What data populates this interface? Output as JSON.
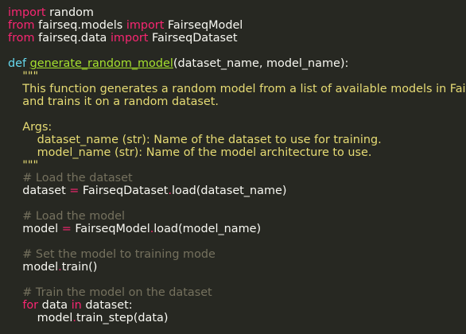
{
  "lines": [
    {
      "segs": [
        {
          "t": "import",
          "c": "kw"
        },
        {
          "t": " random",
          "c": ""
        }
      ]
    },
    {
      "segs": [
        {
          "t": "from",
          "c": "kw"
        },
        {
          "t": " fairseq.models ",
          "c": ""
        },
        {
          "t": "import",
          "c": "kw"
        },
        {
          "t": " FairseqModel",
          "c": ""
        }
      ]
    },
    {
      "segs": [
        {
          "t": "from",
          "c": "kw"
        },
        {
          "t": " fairseq.data ",
          "c": ""
        },
        {
          "t": "import",
          "c": "kw"
        },
        {
          "t": " FairseqDataset",
          "c": ""
        }
      ]
    },
    {
      "segs": []
    },
    {
      "segs": [
        {
          "t": "def",
          "c": "def"
        },
        {
          "t": " ",
          "c": ""
        },
        {
          "t": "generate_random_model",
          "c": "fn"
        },
        {
          "t": "(dataset_name, model_name):",
          "c": ""
        }
      ]
    },
    {
      "segs": [
        {
          "t": "    \"\"\"",
          "c": "str"
        }
      ]
    },
    {
      "segs": [
        {
          "t": "    This function generates a random model from a list of available models in Fairseq",
          "c": "str"
        }
      ]
    },
    {
      "segs": [
        {
          "t": "    and trains it on a random dataset.",
          "c": "str"
        }
      ]
    },
    {
      "segs": []
    },
    {
      "segs": [
        {
          "t": "    Args:",
          "c": "str"
        }
      ]
    },
    {
      "segs": [
        {
          "t": "        dataset_name (str): Name of the dataset to use for training.",
          "c": "str"
        }
      ]
    },
    {
      "segs": [
        {
          "t": "        model_name (str): Name of the model architecture to use.",
          "c": "str"
        }
      ]
    },
    {
      "segs": [
        {
          "t": "    \"\"\"",
          "c": "str"
        }
      ]
    },
    {
      "segs": [
        {
          "t": "    # Load the dataset",
          "c": "cm"
        }
      ]
    },
    {
      "segs": [
        {
          "t": "    dataset ",
          "c": ""
        },
        {
          "t": "=",
          "c": "op"
        },
        {
          "t": " FairseqDataset",
          "c": ""
        },
        {
          "t": ".",
          "c": "op"
        },
        {
          "t": "load(dataset_name)",
          "c": ""
        }
      ]
    },
    {
      "segs": []
    },
    {
      "segs": [
        {
          "t": "    # Load the model",
          "c": "cm"
        }
      ]
    },
    {
      "segs": [
        {
          "t": "    model ",
          "c": ""
        },
        {
          "t": "=",
          "c": "op"
        },
        {
          "t": " FairseqModel",
          "c": ""
        },
        {
          "t": ".",
          "c": "op"
        },
        {
          "t": "load(model_name)",
          "c": ""
        }
      ]
    },
    {
      "segs": []
    },
    {
      "segs": [
        {
          "t": "    # Set the model to training mode",
          "c": "cm"
        }
      ]
    },
    {
      "segs": [
        {
          "t": "    model",
          "c": ""
        },
        {
          "t": ".",
          "c": "op"
        },
        {
          "t": "train()",
          "c": ""
        }
      ]
    },
    {
      "segs": []
    },
    {
      "segs": [
        {
          "t": "    # Train the model on the dataset",
          "c": "cm"
        }
      ]
    },
    {
      "segs": [
        {
          "t": "    ",
          "c": ""
        },
        {
          "t": "for",
          "c": "kw"
        },
        {
          "t": " data ",
          "c": ""
        },
        {
          "t": "in",
          "c": "kw"
        },
        {
          "t": " dataset:",
          "c": ""
        }
      ]
    },
    {
      "segs": [
        {
          "t": "        model",
          "c": ""
        },
        {
          "t": ".",
          "c": "op"
        },
        {
          "t": "train_step(data)",
          "c": ""
        }
      ]
    }
  ]
}
